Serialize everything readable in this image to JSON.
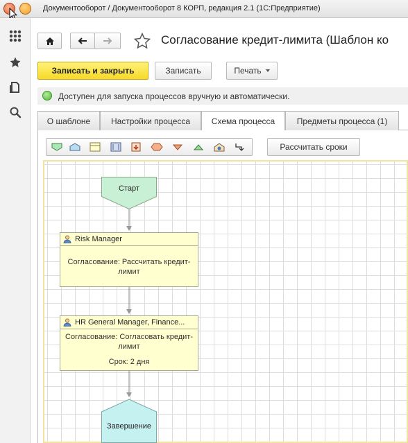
{
  "window": {
    "title": "Документооборот / Документооборот 8 КОРП, редакция 2.1  (1С:Предприятие)"
  },
  "sidebar": {
    "items": [
      {
        "icon": "apps-grid-icon"
      },
      {
        "icon": "favorites-star-icon"
      },
      {
        "icon": "history-icon"
      },
      {
        "icon": "search-icon"
      }
    ]
  },
  "header": {
    "title": "Согласование кредит-лимита (Шаблон ко"
  },
  "toolbar": {
    "save_close_label": "Записать и закрыть",
    "save_label": "Записать",
    "print_label": "Печать"
  },
  "status": {
    "text": "Доступен для запуска процессов вручную и автоматически.",
    "color": "#4cb53a"
  },
  "tabs": [
    {
      "label": "О шаблоне",
      "active": false
    },
    {
      "label": "Настройки процесса",
      "active": false
    },
    {
      "label": "Схема процесса",
      "active": true
    },
    {
      "label": "Предметы процесса (1)",
      "active": false
    }
  ],
  "scheme_toolbar": {
    "calc_label": "Рассчитать сроки"
  },
  "scheme": {
    "start_label": "Старт",
    "end_label": "Завершение",
    "task1": {
      "performer": "Risk Manager",
      "text_line1": "Согласование: Рассчитать кредит-",
      "text_line2": "лимит"
    },
    "task2": {
      "performer": "HR  General  Manager,  Finance...",
      "text_line1": "Согласование: Согласовать кредит-",
      "text_line2": "лимит",
      "deadline": "Срок: 2 дня"
    }
  },
  "colors": {
    "primary_button": "#f7d928",
    "start_node": "#c8f0d4",
    "end_node": "#c6f1f1",
    "task_fill": "#ffffcf"
  }
}
